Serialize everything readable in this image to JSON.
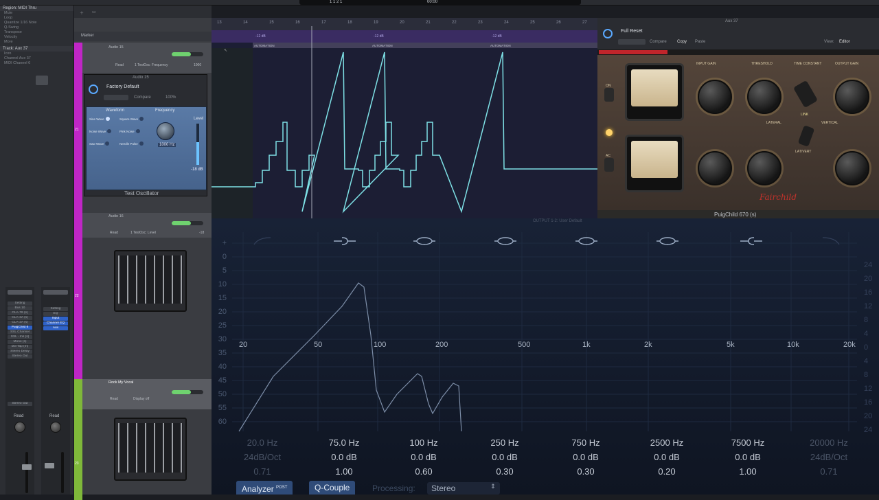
{
  "topbar": {
    "counter": "1 1 2 1",
    "tempo": "00:00"
  },
  "inspector": {
    "region_header": "Region: MIDI Thru",
    "region_rows": [
      "Mute",
      "Loop",
      "Quantize  1/16 Note",
      "Q-Swing",
      "Transpose",
      "Velocity",
      "More"
    ],
    "track_header": "Track: Aux 37",
    "track_rows": [
      "Icon",
      "Channel  Aux 37",
      "MIDI Channel  6"
    ],
    "strip_left": {
      "slots": [
        "Setting",
        "Bus 10",
        "CLA-76 (s)",
        "CLA-3A (s)",
        "CLA-2A (s)",
        "PuigChild 6",
        "SSL Channel",
        "SSL - Ins (s)",
        "Mono (s)",
        "Dbl Tap (m)",
        "Stereo Delay",
        "Stereo Out"
      ],
      "label": "Read",
      "out": "Stereo Out"
    },
    "strip_right": {
      "slots": [
        "Setting",
        "EQ",
        "Input",
        "Channel EQ",
        "Aux"
      ],
      "label": "Read"
    }
  },
  "tracks": {
    "items": [
      {
        "name": "Audio 15",
        "mode": "Read",
        "param": "1 TestOsc: Frequency",
        "value": "1000"
      },
      {
        "name": "Audio 16",
        "mode": "Read",
        "param": "1 TestOsc: Level",
        "value": "-18"
      },
      {
        "name": "Rock My Vocal",
        "mode": "Read",
        "param": "Display off"
      }
    ],
    "marker": "Marker",
    "numbers": [
      "21",
      "22",
      "23",
      "24"
    ]
  },
  "testosc": {
    "title": "Audio 15",
    "preset": "Factory Default",
    "compare": "Compare",
    "zoom": "100%",
    "section_waveform": "Waveform",
    "section_frequency": "Frequency",
    "waveforms": [
      "Sine Wave",
      "Square Wave",
      "Noise Wave",
      "Pink Noise",
      "Saw Wave",
      "Needle Pulse"
    ],
    "freq_value": "1000 Hz",
    "level_label": "Level",
    "level_value": "-18 dB",
    "name": "Test Oscillator"
  },
  "automation": {
    "lane_labels": [
      "-12 dB",
      "-12 dB",
      "-12 dB"
    ],
    "region_labels": [
      "AUTOMATION",
      "AUTOMATION",
      "AUTOMATION"
    ],
    "ruler": [
      "13",
      "14",
      "15",
      "16",
      "17",
      "18",
      "19",
      "20",
      "21",
      "22",
      "23",
      "24",
      "25",
      "26",
      "27"
    ],
    "line_color": "#7ee1e6"
  },
  "pultec": {
    "preset": "Full Reset",
    "compare": "Compare",
    "copy": "Copy",
    "paste": "Paste",
    "view_label": "View:",
    "view_value": "Editor",
    "title": "Aux 37",
    "footer": "PuigChild 670 (s)",
    "brand": "Fairchild",
    "labels": [
      "INPUT GAIN",
      "THRESHOLD",
      "TIME CONSTANT",
      "OUTPUT GAIN",
      "LATERAL",
      "VERTICAL",
      "LINK",
      "LAT/VERT"
    ],
    "on_label": "ON",
    "ac_label": "AC"
  },
  "eq": {
    "title": "OUTPUT 1-2: User Default",
    "db_left": [
      "+",
      "0",
      "5",
      "10",
      "15",
      "20",
      "25",
      "30",
      "35",
      "40",
      "45",
      "50",
      "55",
      "60"
    ],
    "db_right": [
      "24",
      "20",
      "16",
      "12",
      "8",
      "4",
      "0",
      "4",
      "8",
      "12",
      "16",
      "20",
      "24"
    ],
    "freq_labels": [
      "20",
      "50",
      "100",
      "200",
      "500",
      "1k",
      "2k",
      "5k",
      "10k",
      "20k"
    ],
    "bands": [
      {
        "freq": "20.0 Hz",
        "gain": "24dB/Oct",
        "q": "0.71",
        "active": false
      },
      {
        "freq": "75.0 Hz",
        "gain": "0.0 dB",
        "q": "1.00",
        "active": true
      },
      {
        "freq": "100 Hz",
        "gain": "0.0 dB",
        "q": "0.60",
        "active": true
      },
      {
        "freq": "250 Hz",
        "gain": "0.0 dB",
        "q": "0.30",
        "active": true
      },
      {
        "freq": "750 Hz",
        "gain": "0.0 dB",
        "q": "0.30",
        "active": true
      },
      {
        "freq": "2500 Hz",
        "gain": "0.0 dB",
        "q": "0.20",
        "active": true
      },
      {
        "freq": "7500 Hz",
        "gain": "0.0 dB",
        "q": "1.00",
        "active": true
      },
      {
        "freq": "20000 Hz",
        "gain": "24dB/Oct",
        "q": "0.71",
        "active": false
      }
    ],
    "analyzer": "Analyzer",
    "analyzer_badge": "POST",
    "qcouple": "Q-Couple",
    "processing_label": "Processing:",
    "processing_value": "Stereo",
    "analyzer_color": "#7d8ea8"
  },
  "colors": {
    "magenta": "#c026c6",
    "green": "#7fb83a",
    "plugin_blue": "#4b6b99"
  }
}
